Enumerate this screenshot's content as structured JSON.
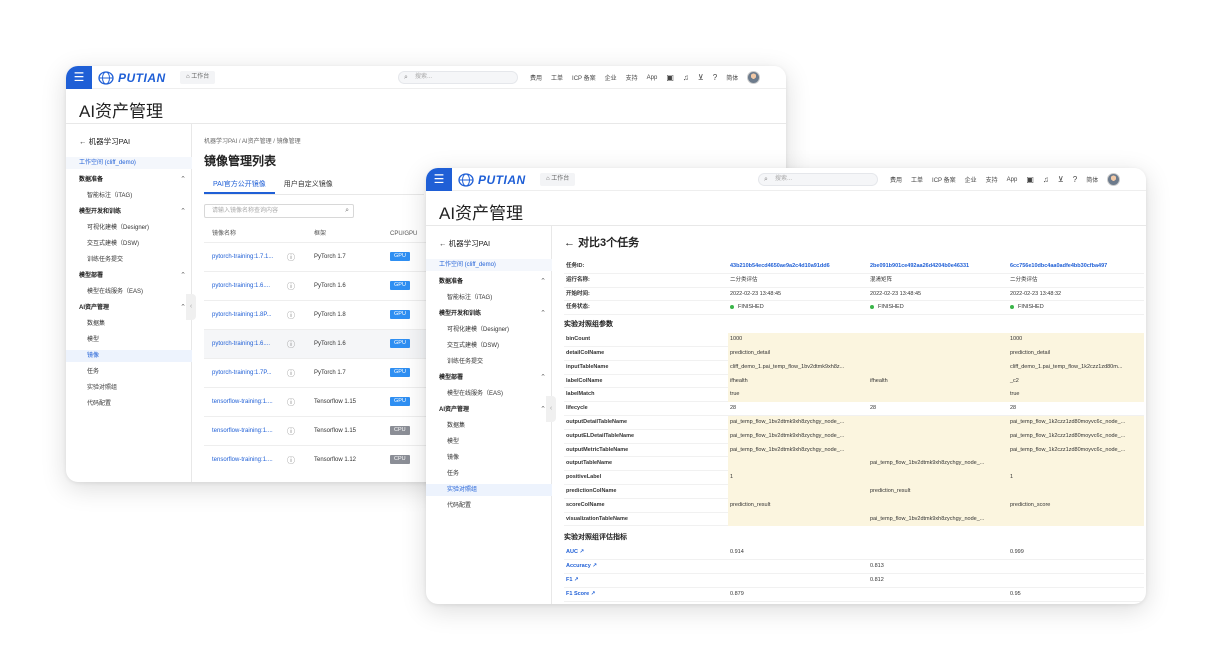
{
  "brand": {
    "name": "PUTIAN",
    "workbench": "工作台",
    "search_placeholder": "搜索..."
  },
  "nav": {
    "links": [
      "费用",
      "工单",
      "ICP 备案",
      "企业",
      "支持",
      "App"
    ],
    "lang": "简体"
  },
  "page_title": "AI资产管理",
  "sidebar": {
    "back_label": "机器学习PAI",
    "workspace": "工作空间 (cliff_demo)",
    "items": [
      {
        "label": "数据准备",
        "group": true
      },
      {
        "label": "智能标注（iTAG)",
        "group": false
      },
      {
        "label": "模型开发和训练",
        "group": true
      },
      {
        "label": "可视化建模（Designer)",
        "group": false
      },
      {
        "label": "交互式建模（DSW)",
        "group": false
      },
      {
        "label": "训练任务提交",
        "group": false
      },
      {
        "label": "模型部署",
        "group": true
      },
      {
        "label": "模型在线服务（EAS)",
        "group": false
      },
      {
        "label": "AI资产管理",
        "group": true
      },
      {
        "label": "数据集",
        "group": false
      },
      {
        "label": "模型",
        "group": false
      },
      {
        "label": "镜像",
        "group": false
      },
      {
        "label": "任务",
        "group": false
      },
      {
        "label": "实验对照组",
        "group": false
      },
      {
        "label": "代码配置",
        "group": false
      }
    ]
  },
  "image_page": {
    "breadcrumb": "机器学习PAI  /  AI资产管理  /  镜像管理",
    "title": "镜像管理列表",
    "tabs": [
      "PAI官方公开镜像",
      "用户自定义镜像"
    ],
    "search_placeholder": "请输入镜像名称查询内容",
    "columns": [
      "镜像名称",
      "框架",
      "CPU/GPU"
    ],
    "rows": [
      {
        "name": "pytorch-training:1.7.1...",
        "framework": "PyTorch 1.7",
        "device": "GPU"
      },
      {
        "name": "pytorch-training:1.6....",
        "framework": "PyTorch 1.6",
        "device": "GPU"
      },
      {
        "name": "pytorch-training:1.8P...",
        "framework": "PyTorch 1.8",
        "device": "GPU"
      },
      {
        "name": "pytorch-training:1.6....",
        "framework": "PyTorch 1.6",
        "device": "GPU"
      },
      {
        "name": "pytorch-training:1.7P...",
        "framework": "PyTorch 1.7",
        "device": "GPU"
      },
      {
        "name": "tensorflow-training:1....",
        "framework": "Tensorflow 1.15",
        "device": "GPU"
      },
      {
        "name": "tensorflow-training:1....",
        "framework": "Tensorflow 1.15",
        "device": "CPU"
      },
      {
        "name": "tensorflow-training:1....",
        "framework": "Tensorflow 1.12",
        "device": "CPU"
      }
    ]
  },
  "compare_page": {
    "title": "对比3个任务",
    "info_rows": [
      {
        "key": "任务ID:",
        "v": [
          "43b210b54ecd4650ae9a2c4d10a91dd6",
          "2be091b901ce492aa26d4204b0e46331",
          "6cc756e10dbc4aa0adfe4bb30cfba497"
        ],
        "link": true
      },
      {
        "key": "运行名称:",
        "v": [
          "二分类评估",
          "混淆矩阵",
          "二分类评估"
        ]
      },
      {
        "key": "开始时间:",
        "v": [
          "2022-02-23 13:48:45",
          "2022-02-23 13:48:45",
          "2022-02-23 13:48:32"
        ]
      },
      {
        "key": "任务状态:",
        "v": [
          "FINISHED",
          "FINISHED",
          "FINISHED"
        ],
        "status": true
      }
    ],
    "param_title": "实验对照组参数",
    "param_rows": [
      {
        "key": "binCount",
        "v": [
          "1000",
          "",
          "1000"
        ],
        "hl": true
      },
      {
        "key": "detailColName",
        "v": [
          "prediction_detail",
          "",
          "prediction_detail"
        ],
        "hl": true
      },
      {
        "key": "inputTableName",
        "v": [
          "cliff_demo_1.pai_temp_flow_1bv2dtmk9xh8z...",
          "",
          "cliff_demo_1.pai_temp_flow_1k2czz1zd80m..."
        ],
        "hl": true
      },
      {
        "key": "labelColName",
        "v": [
          "ifhealth",
          "ifhealth",
          "_c2"
        ],
        "hl": true
      },
      {
        "key": "labelMatch",
        "v": [
          "true",
          "",
          "true"
        ],
        "hl": true
      },
      {
        "key": "lifecycle",
        "v": [
          "28",
          "28",
          "28"
        ],
        "hl": false
      },
      {
        "key": "outputDetailTableName",
        "v": [
          "pai_temp_flow_1bv2dtmk9xh8zychgy_node_...",
          "",
          "pai_temp_flow_1k2czz1zd80moyvc6c_node_..."
        ],
        "hl": true
      },
      {
        "key": "outputELDetailTableName",
        "v": [
          "pai_temp_flow_1bv2dtmk9xh8zychgy_node_...",
          "",
          "pai_temp_flow_1k2czz1zd80moyvc6c_node_..."
        ],
        "hl": true
      },
      {
        "key": "outputMetricTableName",
        "v": [
          "pai_temp_flow_1bv2dtmk9xh8zychgy_node_...",
          "",
          "pai_temp_flow_1k2czz1zd80moyvc6c_node_..."
        ],
        "hl": true
      },
      {
        "key": "outputTableName",
        "v": [
          "",
          "pai_temp_flow_1bv2dtmk9xh8zychgy_node_...",
          ""
        ],
        "hl": true
      },
      {
        "key": "positiveLabel",
        "v": [
          "1",
          "",
          "1"
        ],
        "hl": true
      },
      {
        "key": "predictionColName",
        "v": [
          "",
          "prediction_result",
          ""
        ],
        "hl": true
      },
      {
        "key": "scoreColName",
        "v": [
          "prediction_result",
          "",
          "prediction_score"
        ],
        "hl": true
      },
      {
        "key": "visualizationTableName",
        "v": [
          "",
          "pai_temp_flow_1bv2dtmk9xh8zychgy_node_...",
          ""
        ],
        "hl": true
      }
    ],
    "metric_title": "实验对照组评估指标",
    "metric_rows": [
      {
        "key": "AUC",
        "v": [
          "0.914",
          "",
          "0.999"
        ]
      },
      {
        "key": "Accuracy",
        "v": [
          "",
          "0.813",
          ""
        ]
      },
      {
        "key": "F1",
        "v": [
          "",
          "0.812",
          ""
        ]
      },
      {
        "key": "F1 Score",
        "v": [
          "0.879",
          "",
          "0.95"
        ]
      }
    ]
  }
}
